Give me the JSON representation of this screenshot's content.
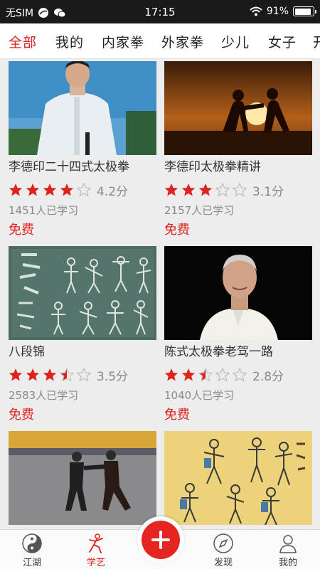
{
  "status_bar": {
    "carrier": "无SIM",
    "time": "17:15",
    "battery": "91%",
    "battery_level": 0.91
  },
  "tabs": [
    {
      "label": "全部",
      "active": true
    },
    {
      "label": "我的",
      "active": false
    },
    {
      "label": "内家拳",
      "active": false
    },
    {
      "label": "外家拳",
      "active": false
    },
    {
      "label": "少儿",
      "active": false
    },
    {
      "label": "女子",
      "active": false
    },
    {
      "label": "开",
      "active": false
    }
  ],
  "courses": [
    {
      "title": "李德印二十四式太极拳",
      "rating": 4.2,
      "score": "4.2分",
      "learners": "1451人已学习",
      "price": "免费",
      "image": "man-in-white-robe-photo"
    },
    {
      "title": "李德印太极拳精讲",
      "rating": 3.1,
      "score": "3.1分",
      "learners": "2157人已学习",
      "price": "免费",
      "image": "sunset-silhouette-sparring-photo"
    },
    {
      "title": "八段锦",
      "rating": 3.5,
      "score": "3.5分",
      "learners": "2583人已学习",
      "price": "免费",
      "image": "baduanjin-illustration"
    },
    {
      "title": "陈式太极拳老驾一路",
      "rating": 2.8,
      "score": "2.8分",
      "learners": "1040人已学习",
      "price": "免费",
      "image": "elderly-master-portrait-photo"
    },
    {
      "title": "",
      "rating": null,
      "score": "",
      "learners": "",
      "price": "",
      "image": "sparring-on-mat-photo"
    },
    {
      "title": "",
      "rating": null,
      "score": "",
      "learners": "",
      "price": "",
      "image": "wuqinxi-illustration"
    }
  ],
  "bottom_nav": [
    {
      "label": "江湖",
      "icon": "taiji-icon",
      "active": false
    },
    {
      "label": "学艺",
      "icon": "kungfu-figure-icon",
      "active": true
    },
    {
      "label": "",
      "icon": "plus-icon",
      "active": false
    },
    {
      "label": "发现",
      "icon": "compass-icon",
      "active": false
    },
    {
      "label": "我的",
      "icon": "person-icon",
      "active": false
    }
  ],
  "colors": {
    "accent": "#e0221c",
    "star": "#e0221c",
    "star_empty": "#bbbbbb"
  }
}
